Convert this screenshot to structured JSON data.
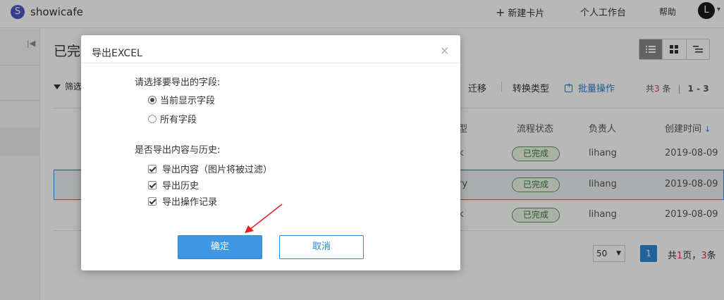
{
  "header": {
    "logo_letter": "S",
    "brand": "showicafe",
    "new_card": "新建卡片",
    "workspace": "个人工作台",
    "help": "帮助",
    "avatar_letter": "L"
  },
  "page": {
    "title_partial": "已完",
    "filter_partial": "筛选",
    "actions": {
      "migrate": "迁移",
      "convert_type": "转换类型",
      "batch": "批量操作"
    },
    "count": {
      "prefix": "共",
      "total": "3",
      "suffix": "条",
      "range": "1 - 3"
    },
    "columns": {
      "type_partial": "型",
      "status": "流程状态",
      "owner": "负责人",
      "created": "创建时间"
    },
    "rows": [
      {
        "type_partial": "k",
        "status": "已完成",
        "owner": "lihang",
        "created": "2019-08-09"
      },
      {
        "type_partial": "ry",
        "status": "已完成",
        "owner": "lihang",
        "created": "2019-08-09"
      },
      {
        "type_partial": "k",
        "status": "已完成",
        "owner": "lihang",
        "created": "2019-08-09"
      }
    ],
    "pager": {
      "page_size": "50",
      "current": "1",
      "total_prefix": "共",
      "total_pages": "1",
      "pages_suffix": "页，",
      "total_items": "3",
      "items_suffix": "条"
    }
  },
  "modal": {
    "title": "导出EXCEL",
    "close": "×",
    "fields_label": "请选择要导出的字段:",
    "field_options": [
      {
        "label": "当前显示字段",
        "checked": true
      },
      {
        "label": "所有字段",
        "checked": false
      }
    ],
    "history_label": "是否导出内容与历史:",
    "history_options": [
      {
        "label": "导出内容（图片将被过滤）",
        "checked": true
      },
      {
        "label": "导出历史",
        "checked": true
      },
      {
        "label": "导出操作记录",
        "checked": true
      }
    ],
    "ok": "确定",
    "cancel": "取消"
  },
  "colors": {
    "accent": "#2b89d6",
    "badge_green": "#5b9a55",
    "count_red": "#e0383e",
    "annotation_arrow": "#e02424"
  }
}
